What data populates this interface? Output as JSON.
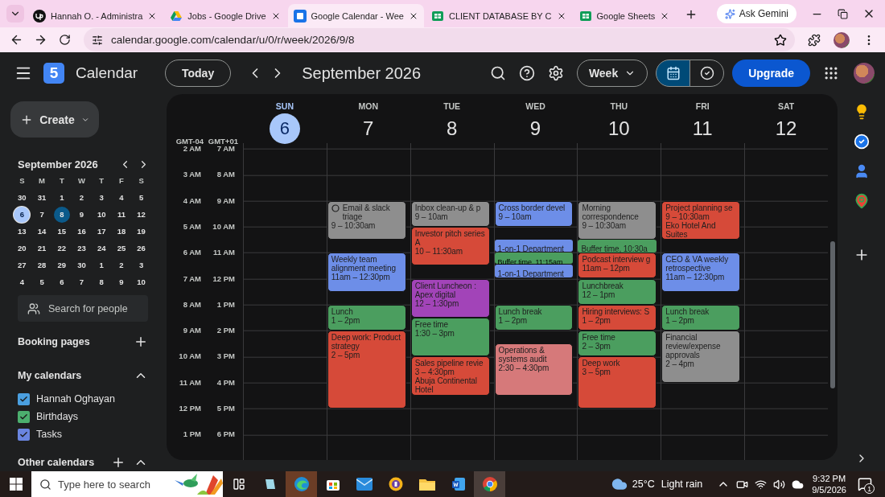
{
  "browser": {
    "tabs": [
      {
        "kind": "profile",
        "title": "Hannah O. - Administra",
        "selected": false
      },
      {
        "kind": "drive",
        "title": "Jobs - Google Drive",
        "selected": false
      },
      {
        "kind": "calendar",
        "title": "Google Calendar - Wee",
        "selected": true
      },
      {
        "kind": "sheet",
        "title": "CLIENT DATABASE BY C",
        "selected": false
      },
      {
        "kind": "sheet",
        "title": "Google Sheets",
        "selected": false
      }
    ],
    "ask_button": "Ask Gemini",
    "address": "calendar.google.com/calendar/u/0/r/week/2026/9/8"
  },
  "header": {
    "logo_day": "5",
    "app_name": "Calendar",
    "today_button": "Today",
    "period": "September 2026",
    "view": "Week",
    "view_toggle": [
      {
        "kind": "calendar",
        "selected": true
      },
      {
        "kind": "tasks",
        "selected": false
      }
    ],
    "upgrade_button": "Upgrade"
  },
  "sidebar": {
    "create_button": "Create",
    "mini_calendar": {
      "title": "September 2026",
      "weekdays": [
        "S",
        "M",
        "T",
        "W",
        "T",
        "F",
        "S"
      ],
      "days": [
        {
          "label": "30",
          "today": false,
          "selected": false
        },
        {
          "label": "31",
          "today": false,
          "selected": false
        },
        {
          "label": "1",
          "today": false,
          "selected": false
        },
        {
          "label": "2",
          "today": false,
          "selected": false
        },
        {
          "label": "3",
          "today": false,
          "selected": false
        },
        {
          "label": "4",
          "today": false,
          "selected": false
        },
        {
          "label": "5",
          "today": false,
          "selected": false
        },
        {
          "label": "6",
          "today": true,
          "selected": false
        },
        {
          "label": "7",
          "today": false,
          "selected": false
        },
        {
          "label": "8",
          "today": false,
          "selected": true
        },
        {
          "label": "9",
          "today": false,
          "selected": false
        },
        {
          "label": "10",
          "today": false,
          "selected": false
        },
        {
          "label": "11",
          "today": false,
          "selected": false
        },
        {
          "label": "12",
          "today": false,
          "selected": false
        },
        {
          "label": "13",
          "today": false,
          "selected": false
        },
        {
          "label": "14",
          "today": false,
          "selected": false
        },
        {
          "label": "15",
          "today": false,
          "selected": false
        },
        {
          "label": "16",
          "today": false,
          "selected": false
        },
        {
          "label": "17",
          "today": false,
          "selected": false
        },
        {
          "label": "18",
          "today": false,
          "selected": false
        },
        {
          "label": "19",
          "today": false,
          "selected": false
        },
        {
          "label": "20",
          "today": false,
          "selected": false
        },
        {
          "label": "21",
          "today": false,
          "selected": false
        },
        {
          "label": "22",
          "today": false,
          "selected": false
        },
        {
          "label": "23",
          "today": false,
          "selected": false
        },
        {
          "label": "24",
          "today": false,
          "selected": false
        },
        {
          "label": "25",
          "today": false,
          "selected": false
        },
        {
          "label": "26",
          "today": false,
          "selected": false
        },
        {
          "label": "27",
          "today": false,
          "selected": false
        },
        {
          "label": "28",
          "today": false,
          "selected": false
        },
        {
          "label": "29",
          "today": false,
          "selected": false
        },
        {
          "label": "30",
          "today": false,
          "selected": false
        },
        {
          "label": "1",
          "today": false,
          "selected": false
        },
        {
          "label": "2",
          "today": false,
          "selected": false
        },
        {
          "label": "3",
          "today": false,
          "selected": false
        },
        {
          "label": "4",
          "today": false,
          "selected": false
        },
        {
          "label": "5",
          "today": false,
          "selected": false
        },
        {
          "label": "6",
          "today": false,
          "selected": false
        },
        {
          "label": "7",
          "today": false,
          "selected": false
        },
        {
          "label": "8",
          "today": false,
          "selected": false
        },
        {
          "label": "9",
          "today": false,
          "selected": false
        },
        {
          "label": "10",
          "today": false,
          "selected": false
        }
      ]
    },
    "search_people": {
      "placeholder": "Search for people"
    },
    "booking_pages": "Booking pages",
    "my_calendars": {
      "title": "My calendars",
      "expanded": true,
      "items": [
        {
          "name": "Hannah Oghayan",
          "checked": true,
          "color": "#4a9fe0"
        },
        {
          "name": "Birthdays",
          "checked": true,
          "color": "#4caf6e"
        },
        {
          "name": "Tasks",
          "checked": true,
          "color": "#6a85e0"
        }
      ]
    },
    "other_calendars": {
      "title": "Other calendars",
      "expanded": true
    }
  },
  "week": {
    "timezones": [
      {
        "name": "GMT-04",
        "hours": [
          "2 AM",
          "3 AM",
          "4 AM",
          "5 AM",
          "6 AM",
          "7 AM",
          "8 AM",
          "9 AM",
          "10 AM",
          "11 AM",
          "12 PM",
          "1 PM"
        ]
      },
      {
        "name": "GMT+01",
        "hours": [
          "7 AM",
          "8 AM",
          "9 AM",
          "10 AM",
          "11 AM",
          "12 PM",
          "1 PM",
          "2 PM",
          "3 PM",
          "4 PM",
          "5 PM",
          "6 PM"
        ]
      }
    ],
    "days": [
      {
        "name": "SUN",
        "date": "6",
        "today": true
      },
      {
        "name": "MON",
        "date": "7",
        "today": false,
        "events": [
          {
            "kind": "task",
            "title": "Email & slack triage",
            "time": "9 – 10:30am",
            "color": "#8e8e8e"
          },
          {
            "kind": "event",
            "title": "Weekly team alignment meeting",
            "time": "11am – 12:30pm",
            "color": "#6d8ee8"
          },
          {
            "kind": "event",
            "title": "Lunch",
            "time": "1 – 2pm",
            "color": "#4b9e5f"
          },
          {
            "kind": "event",
            "title": "Deep work: Product strategy",
            "time": "2 – 5pm",
            "color": "#d64a39"
          }
        ]
      },
      {
        "name": "TUE",
        "date": "8",
        "today": false,
        "events": [
          {
            "kind": "event",
            "title": "Inbox clean-up & p",
            "time": "9 – 10am",
            "color": "#8e8e8e"
          },
          {
            "kind": "event",
            "title": "Investor pitch series A",
            "time": "10 – 11:30am",
            "color": "#d64a39"
          },
          {
            "kind": "event",
            "title": "Client Luncheon : Apex digital",
            "time": "12 – 1:30pm",
            "color": "#a244b8"
          },
          {
            "kind": "event",
            "title": "Free time",
            "time": "1:30 – 3pm",
            "color": "#4b9e5f"
          },
          {
            "kind": "event",
            "title": "Sales pipeline revie",
            "time": "3 – 4:30pm",
            "location": "Abuja Continental Hotel",
            "color": "#d64a39"
          }
        ]
      },
      {
        "name": "WED",
        "date": "9",
        "today": false,
        "events": [
          {
            "kind": "event",
            "title": "Cross border devel",
            "time": "9 – 10am",
            "color": "#6d8ee8"
          },
          {
            "kind": "short",
            "title": "1-on-1 Department",
            "color": "#6d8ee8"
          },
          {
            "kind": "thin",
            "title": "Buffer time, 11:15am",
            "color": "#4b9e5f"
          },
          {
            "kind": "short",
            "title": "1-on-1 Department",
            "color": "#6d8ee8"
          },
          {
            "kind": "event",
            "title": "Lunch break",
            "time": "1 – 2pm",
            "color": "#4b9e5f"
          },
          {
            "kind": "event",
            "title": "Operations & systems audit",
            "time": "2:30 – 4:30pm",
            "color": "#d6797a"
          }
        ]
      },
      {
        "name": "THU",
        "date": "10",
        "today": false,
        "events": [
          {
            "kind": "event",
            "title": "Morning correspondence",
            "time": "9 – 10:30am",
            "color": "#8e8e8e"
          },
          {
            "kind": "short",
            "title": "Buffer time, 10:30a",
            "color": "#4b9e5f"
          },
          {
            "kind": "event",
            "title": "Podcast interview g",
            "time": "11am – 12pm",
            "color": "#d64a39"
          },
          {
            "kind": "event",
            "title": "Lunchbreak",
            "time": "12 – 1pm",
            "color": "#4b9e5f"
          },
          {
            "kind": "event",
            "title": "Hiring interviews: S",
            "time": "1 – 2pm",
            "color": "#d64a39"
          },
          {
            "kind": "event",
            "title": "Free time",
            "time": "2 – 3pm",
            "color": "#4b9e5f"
          },
          {
            "kind": "event",
            "title": "Deep work",
            "time": "3 – 5pm",
            "color": "#d64a39"
          }
        ]
      },
      {
        "name": "FRI",
        "date": "11",
        "today": false,
        "events": [
          {
            "kind": "event",
            "title": "Project planning se",
            "time": "9 – 10:30am",
            "location": "Eko Hotel And Suites",
            "color": "#d64a39"
          },
          {
            "kind": "event",
            "title": "CEO & VA weekly retrospective",
            "time": "11am – 12:30pm",
            "color": "#6d8ee8"
          },
          {
            "kind": "event",
            "title": "Lunch break",
            "time": "1 – 2pm",
            "color": "#4b9e5f"
          },
          {
            "kind": "event",
            "title": "Financial review/expense approvals",
            "time": "2 – 4pm",
            "color": "#8e8e8e"
          }
        ]
      },
      {
        "name": "SAT",
        "date": "12",
        "today": false
      }
    ]
  },
  "taskbar": {
    "search": {
      "placeholder": "Type here to search"
    },
    "temperature": "25°C",
    "weather": "Light rain",
    "time": "9:32 PM",
    "date": "9/5/2026",
    "notifications": "1"
  }
}
